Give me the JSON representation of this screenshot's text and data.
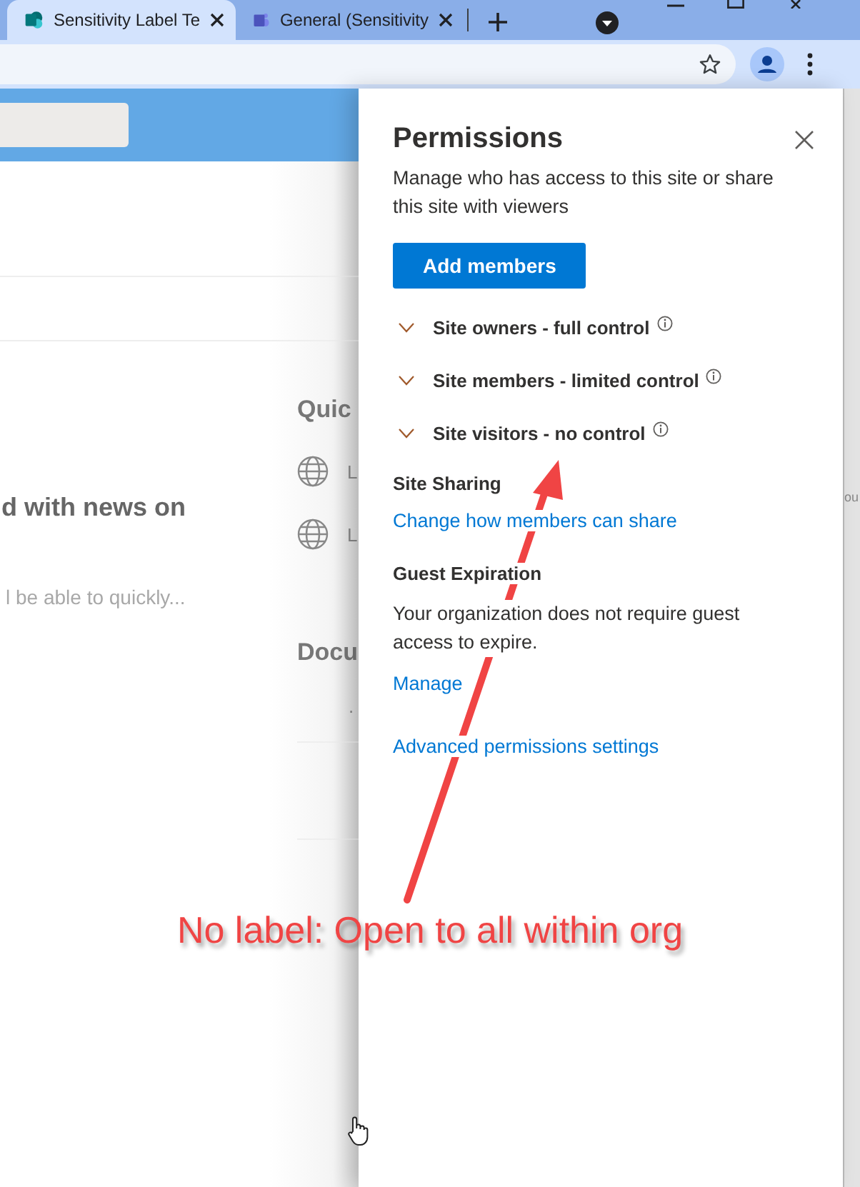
{
  "browser": {
    "tabs": [
      {
        "title": "Sensitivity Label Te",
        "selected": true,
        "kind": "tile"
      },
      {
        "title": "General (Sensitivity",
        "selected": false,
        "kind": "people"
      }
    ]
  },
  "page": {
    "headline": "d with news on",
    "subtext": "l be able to quickly...",
    "side_heading_1": "Quic",
    "quick_links": [
      "L",
      "L"
    ],
    "side_heading_2": "Docu",
    "document_mark": ".",
    "edge_text": "ou"
  },
  "panel": {
    "title": "Permissions",
    "description": "Manage who has access to this site or share this site with viewers",
    "add_button": "Add members",
    "groups": [
      {
        "label": "Site owners - full control",
        "expanded": false
      },
      {
        "label": "Site members - limited control",
        "expanded": false
      },
      {
        "label": "Site visitors - no control",
        "expanded": false
      }
    ],
    "site_sharing": {
      "heading": "Site Sharing",
      "link": "Change how members can share"
    },
    "guest_expiration": {
      "heading": "Guest Expiration",
      "text": "Your organization does not require guest access to expire.",
      "link": "Manage"
    },
    "advanced_link": "Advanced permissions settings"
  },
  "annotation": {
    "text": "No label: Open to all within org"
  }
}
